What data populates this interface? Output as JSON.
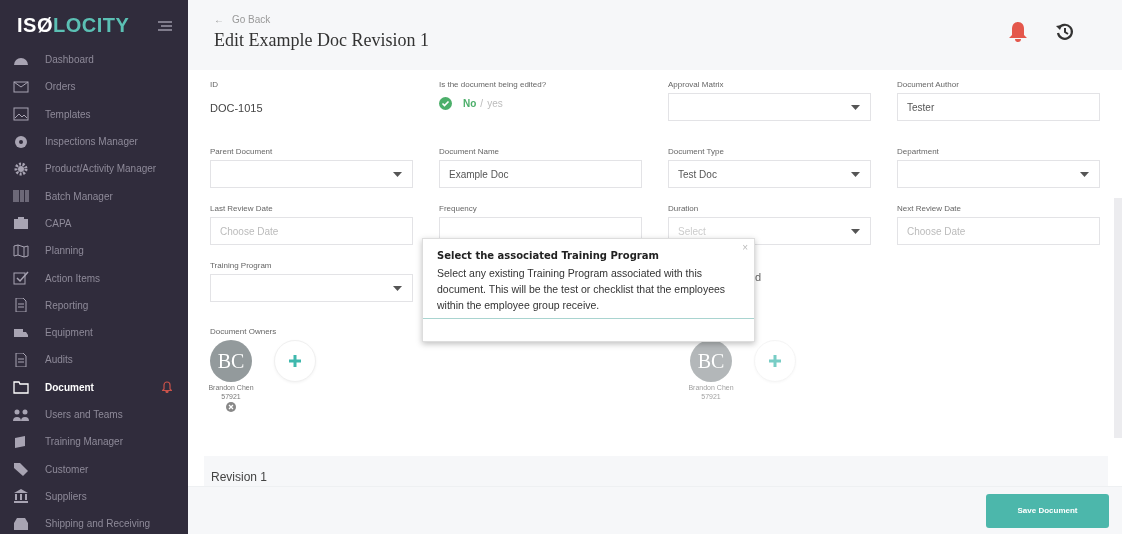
{
  "sidebar": {
    "logo": [
      "ISØ",
      "LOCITY"
    ],
    "items": [
      {
        "label": "Dashboard",
        "selected": false,
        "alert": false
      },
      {
        "label": "Orders",
        "selected": false,
        "alert": false
      },
      {
        "label": "Templates",
        "selected": false,
        "alert": false
      },
      {
        "label": "Inspections Manager",
        "selected": false,
        "alert": false
      },
      {
        "label": "Product/Activity Manager",
        "selected": false,
        "alert": false
      },
      {
        "label": "Batch Manager",
        "selected": false,
        "alert": false
      },
      {
        "label": "CAPA",
        "selected": false,
        "alert": false
      },
      {
        "label": "Planning",
        "selected": false,
        "alert": false
      },
      {
        "label": "Action Items",
        "selected": false,
        "alert": false
      },
      {
        "label": "Reporting",
        "selected": false,
        "alert": false
      },
      {
        "label": "Equipment",
        "selected": false,
        "alert": false
      },
      {
        "label": "Audits",
        "selected": false,
        "alert": false
      },
      {
        "label": "Document",
        "selected": true,
        "alert": true
      },
      {
        "label": "Users and Teams",
        "selected": false,
        "alert": false
      },
      {
        "label": "Training Manager",
        "selected": false,
        "alert": false
      },
      {
        "label": "Customer",
        "selected": false,
        "alert": false
      },
      {
        "label": "Suppliers",
        "selected": false,
        "alert": false
      },
      {
        "label": "Shipping and Receiving",
        "selected": false,
        "alert": false
      }
    ]
  },
  "header": {
    "back_arrow": "←",
    "back": "Go Back",
    "title": "Edit Example Doc Revision 1"
  },
  "fields": [
    {
      "kind": "text",
      "label": "ID",
      "value": "DOC-1015"
    },
    {
      "kind": "toggle",
      "label": "Is the document being edited?",
      "options": [
        {
          "label": "No",
          "selected": true
        },
        {
          "label": "yes",
          "selected": false
        }
      ],
      "separator": "/"
    },
    {
      "kind": "select",
      "label": "Approval Matrix"
    },
    {
      "kind": "input",
      "label": "Document Author",
      "value": "Tester"
    },
    {
      "kind": "select",
      "label": "Parent Document"
    },
    {
      "kind": "input",
      "label": "Document Name",
      "value": "Example Doc"
    },
    {
      "kind": "select",
      "label": "Document Type",
      "value": "Test Doc"
    },
    {
      "kind": "select",
      "label": "Department"
    },
    {
      "kind": "input",
      "label": "Last Review Date",
      "placeholder": "Choose Date"
    },
    {
      "kind": "input",
      "label": "Frequency"
    },
    {
      "kind": "select",
      "label": "Duration",
      "placeholder": "Select"
    },
    {
      "kind": "input",
      "label": "Next Review Date",
      "placeholder": "Choose Date"
    },
    {
      "kind": "select",
      "label": "Training Program"
    },
    {
      "kind": "empty"
    },
    {
      "kind": "fragment",
      "value": "d"
    }
  ],
  "owners": [
    {
      "label": "Document Owners",
      "disabled": false,
      "people": [
        {
          "initials": "BC",
          "name": "Brandon Chen",
          "number": "57921",
          "removable": true
        }
      ]
    },
    {
      "disabled": true,
      "people": [
        {
          "initials": "BC",
          "name": "Brandon Chen",
          "number": "57921",
          "removable": false
        }
      ]
    }
  ],
  "popover": {
    "title": "Select the associated Training Program",
    "text": "Select any existing Training Program associated with this document.  This will be the test or checklist that the employees within the employee group receive.",
    "close": "×"
  },
  "revision": {
    "title": "Revision 1"
  },
  "footer": {
    "button": "Save Document"
  }
}
